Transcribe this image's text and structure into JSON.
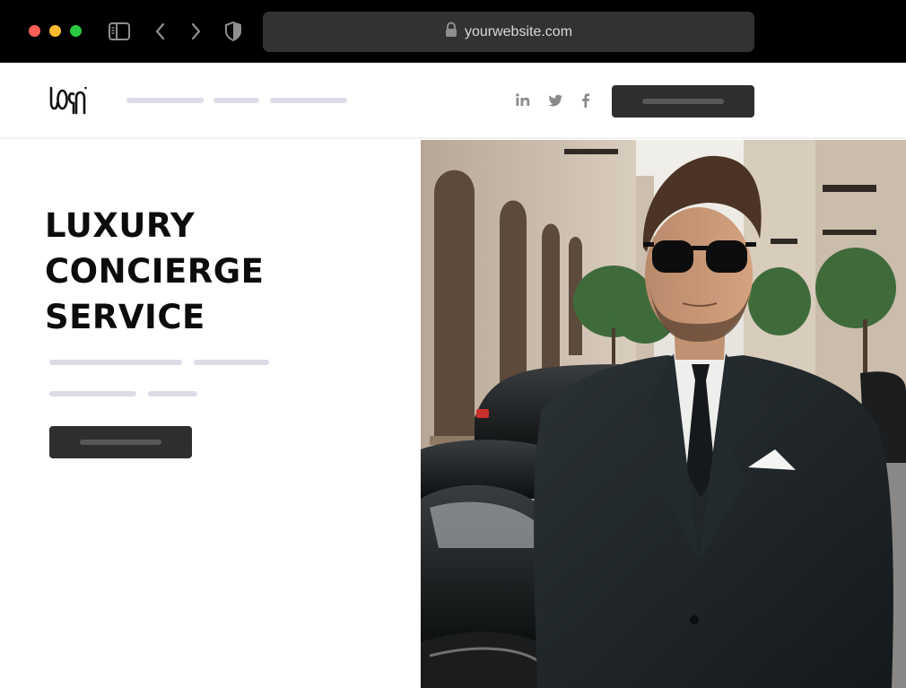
{
  "browser": {
    "url": "yourwebsite.com",
    "icons": [
      "sidebar-toggle-icon",
      "back-arrow-icon",
      "forward-arrow-icon",
      "shield-icon",
      "lock-icon"
    ],
    "traffic_light_colors": [
      "#fe5f57",
      "#febc2e",
      "#28c840"
    ]
  },
  "header": {
    "social_icons": [
      "linkedin-icon",
      "twitter-icon",
      "facebook-icon"
    ]
  },
  "hero": {
    "title_lines": [
      "LUXURY",
      "CONCIERGE",
      "SERVICE"
    ]
  },
  "colors": {
    "accent_dark": "#2e2e2e",
    "placeholder_line": "#dcdce6",
    "text": "#0c0c0c"
  }
}
